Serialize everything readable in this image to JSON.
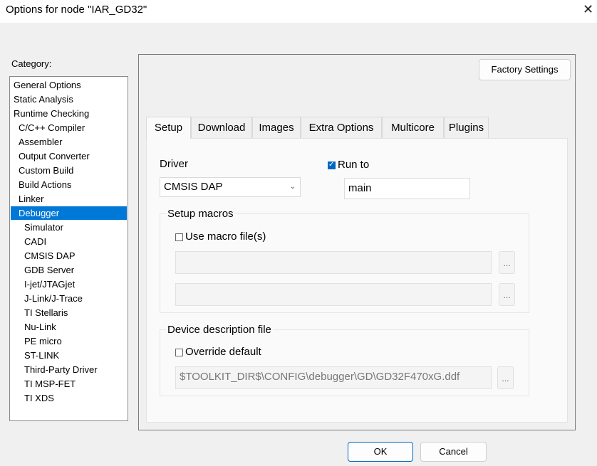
{
  "window": {
    "title": "Options for node \"IAR_GD32\"",
    "close_glyph": "✕"
  },
  "category": {
    "label": "Category:",
    "items": [
      {
        "label": "General Options",
        "level": 0
      },
      {
        "label": "Static Analysis",
        "level": 0
      },
      {
        "label": "Runtime Checking",
        "level": 0
      },
      {
        "label": "C/C++ Compiler",
        "level": 1
      },
      {
        "label": "Assembler",
        "level": 1
      },
      {
        "label": "Output Converter",
        "level": 1
      },
      {
        "label": "Custom Build",
        "level": 1
      },
      {
        "label": "Build Actions",
        "level": 1
      },
      {
        "label": "Linker",
        "level": 1
      },
      {
        "label": "Debugger",
        "level": 1,
        "selected": true
      },
      {
        "label": "Simulator",
        "level": 2
      },
      {
        "label": "CADI",
        "level": 2
      },
      {
        "label": "CMSIS DAP",
        "level": 2
      },
      {
        "label": "GDB Server",
        "level": 2
      },
      {
        "label": "I-jet/JTAGjet",
        "level": 2
      },
      {
        "label": "J-Link/J-Trace",
        "level": 2
      },
      {
        "label": "TI Stellaris",
        "level": 2
      },
      {
        "label": "Nu-Link",
        "level": 2
      },
      {
        "label": "PE micro",
        "level": 2
      },
      {
        "label": "ST-LINK",
        "level": 2
      },
      {
        "label": "Third-Party Driver",
        "level": 2
      },
      {
        "label": "TI MSP-FET",
        "level": 2
      },
      {
        "label": "TI XDS",
        "level": 2
      }
    ]
  },
  "factory_button": "Factory Settings",
  "tabs": [
    {
      "label": "Setup",
      "active": true
    },
    {
      "label": "Download"
    },
    {
      "label": "Images"
    },
    {
      "label": "Extra Options"
    },
    {
      "label": "Multicore"
    },
    {
      "label": "Plugins"
    }
  ],
  "setup": {
    "driver_label": "Driver",
    "driver_value": "CMSIS DAP",
    "run_to_label": "Run to",
    "run_to_checked": true,
    "run_to_value": "main",
    "macros_group_title": "Setup macros",
    "use_macro_label": "Use macro file(s)",
    "use_macro_checked": false,
    "macro_file_1": "",
    "macro_file_2": "",
    "device_group_title": "Device description file",
    "override_label": "Override default",
    "override_checked": false,
    "device_file": "$TOOLKIT_DIR$\\CONFIG\\debugger\\GD\\GD32F470xG.ddf",
    "browse_label": "..."
  },
  "buttons": {
    "ok": "OK",
    "cancel": "Cancel"
  },
  "colors": {
    "selection": "#0078d7",
    "checkbox": "#0067c0"
  }
}
